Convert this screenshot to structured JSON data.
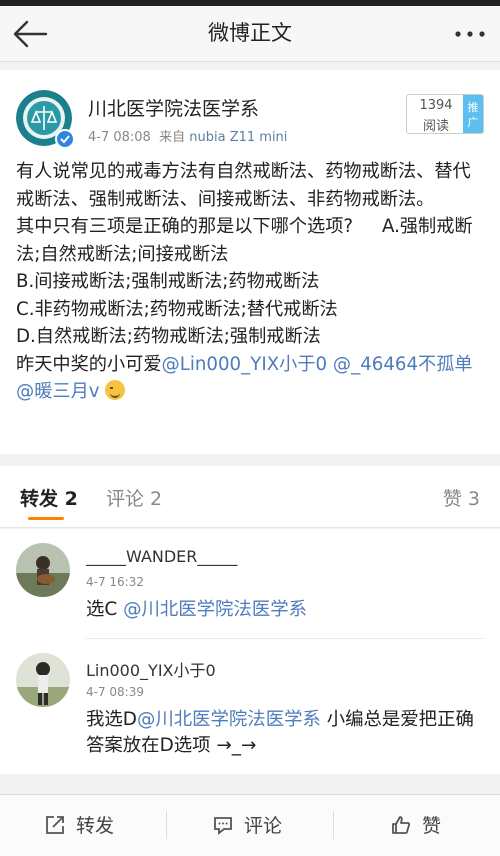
{
  "nav": {
    "title": "微博正文"
  },
  "post": {
    "author": "川北医学院法医学系",
    "time": "4-7 08:08",
    "source_prefix": "来自",
    "source": "nubia Z11 mini",
    "read_count": "1394",
    "read_label": "阅读",
    "promote_label": "推广",
    "paragraph1": "有人说常见的戒毒方法有自然戒断法、药物戒断法、替代戒断法、强制戒断法、间接戒断法、非药物戒断法。",
    "question": "其中只有三项是正确的那是以下哪个选项?",
    "option_a": "A.强制戒断法;自然戒断法;间接戒断法",
    "option_b": "B.间接戒断法;强制戒断法;药物戒断法",
    "option_c": "C.非药物戒断法;药物戒断法;替代戒断法",
    "option_d": "D.自然戒断法;药物戒断法;强制戒断法",
    "winners_text": "昨天中奖的小可爱",
    "mention1": "@Lin000_YIX小于0",
    "mention2": "@_46464不孤单",
    "mention3": "@暖三月v",
    "emoji": "smirk-emoji"
  },
  "tabs": {
    "repost": "转发 2",
    "comment": "评论 2",
    "like": "赞 3"
  },
  "comments": [
    {
      "name": "_____WANDER_____",
      "time": "4-7 16:32",
      "text": "选C ",
      "mention": "@川北医学院法医学系",
      "text_after": ""
    },
    {
      "name": "Lin000_YIX小于0",
      "time": "4-7 08:39",
      "text": "我选D",
      "mention": "@川北医学院法医学系",
      "text_after": " 小编总是爱把正确答案放在D选项 →_→"
    }
  ],
  "bottom": {
    "repost": "转发",
    "comment": "评论",
    "like": "赞"
  },
  "colors": {
    "mention": "#4f7cbd",
    "accent": "#ff8200",
    "promote": "#5bc0f0"
  }
}
